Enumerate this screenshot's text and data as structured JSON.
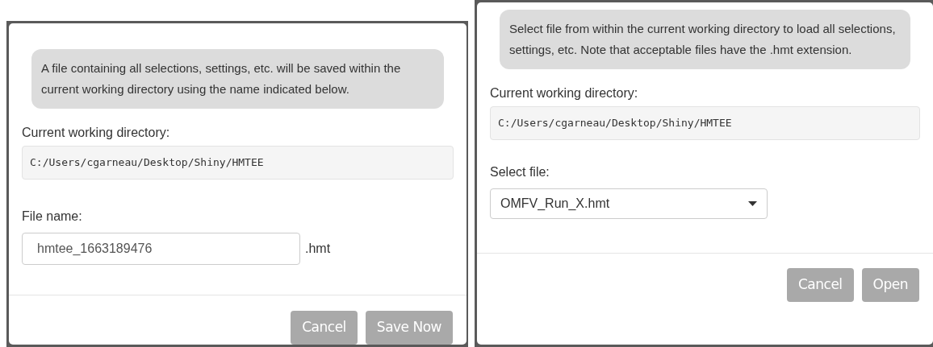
{
  "dialogs": [
    {
      "kind": "save",
      "info": "A file containing all selections, settings, etc. will be saved within the current working directory using the name indicated below.",
      "cwd_label": "Current working directory:",
      "cwd": "C:/Users/cgarneau/Desktop/Shiny/HMTEE",
      "field_label": "File name:",
      "field_value": "hmtee_1663189476",
      "suffix": ".hmt",
      "buttons": [
        "Cancel",
        "Save Now"
      ]
    },
    {
      "kind": "open",
      "info": "Select file from within the current working directory to load all selections, settings, etc. Note that acceptable files have the .hmt extension.",
      "cwd_label": "Current working directory:",
      "cwd": "C:/Users/cgarneau/Desktop/Shiny/HMTEE",
      "field_label": "Select file:",
      "field_value": "OMFV_Run_X.hmt",
      "buttons": [
        "Cancel",
        "Open"
      ]
    }
  ]
}
